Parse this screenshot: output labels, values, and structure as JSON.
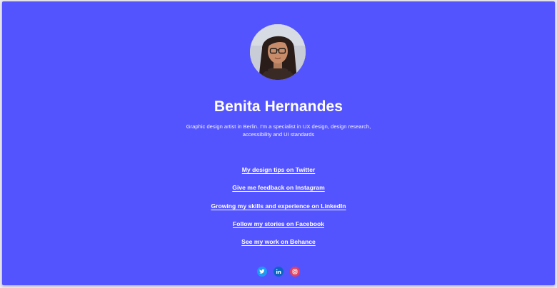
{
  "profile": {
    "name": "Benita Hernandes",
    "bio": "Graphic design artist in Berlin. I'm a specialist in UX design, design research, accessibility and UI standards"
  },
  "links": [
    {
      "label": "My design tips on Twitter"
    },
    {
      "label": "Give me feedback on Instagram"
    },
    {
      "label": "Growing my skills and experience on LinkedIn"
    },
    {
      "label": "Follow my stories on Facebook"
    },
    {
      "label": "See my work on Behance"
    }
  ],
  "socials": [
    {
      "icon": "twitter-icon",
      "color": "#1d9bf0"
    },
    {
      "icon": "linkedin-icon",
      "color": "#0a66c2"
    },
    {
      "icon": "instagram-icon",
      "color": "#e4405f"
    }
  ],
  "theme": {
    "background": "#5454ff",
    "text": "#ffffff"
  }
}
